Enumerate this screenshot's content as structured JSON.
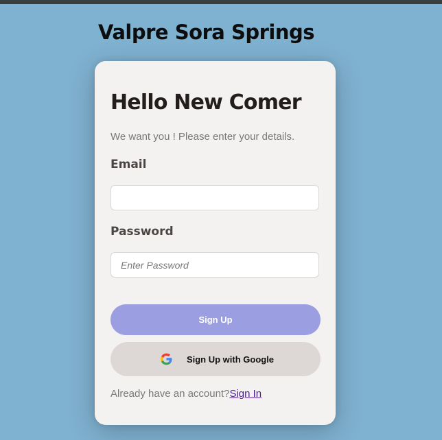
{
  "brand": {
    "title": "Valpre Sora Springs"
  },
  "card": {
    "heading": "Hello New Comer",
    "subtext": "We want you ! Please enter your details.",
    "email_label": "Email",
    "email_value": "",
    "password_label": "Password",
    "password_placeholder": "Enter Password",
    "signup_label": "Sign Up",
    "google_label": "Sign Up with Google",
    "google_icon": "google-g-icon",
    "footer_prompt": "Already have an account?",
    "signin_link": "Sign In"
  },
  "colors": {
    "page_bg": "#7fb1d0",
    "card_bg": "#f4f2f0",
    "signup_button": "#9b9ee1",
    "google_button": "#ddd8d6",
    "link": "#4b1e8c"
  }
}
